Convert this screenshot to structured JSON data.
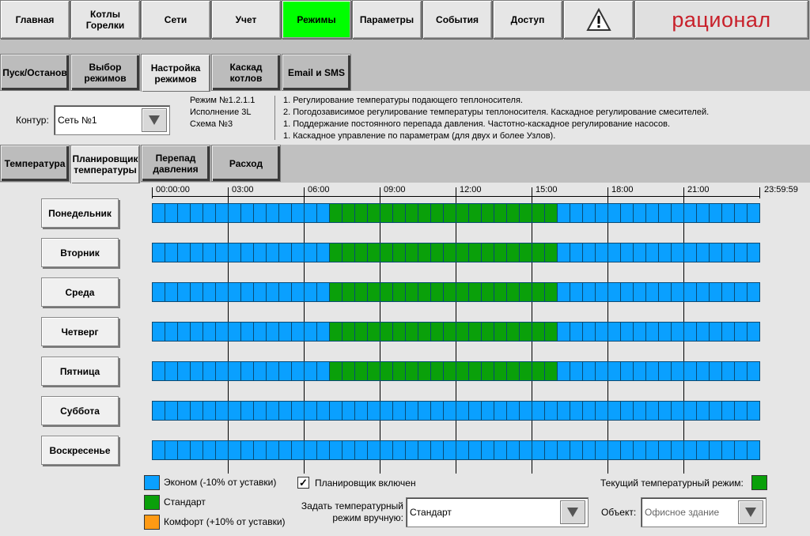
{
  "nav": [
    {
      "label": "Главная",
      "active": false
    },
    {
      "label": "Котлы\nГорелки",
      "active": false
    },
    {
      "label": "Сети",
      "active": false
    },
    {
      "label": "Учет",
      "active": false
    },
    {
      "label": "Режимы",
      "active": true
    },
    {
      "label": "Параметры",
      "active": false
    },
    {
      "label": "События",
      "active": false
    },
    {
      "label": "Доступ",
      "active": false
    }
  ],
  "brand": {
    "logo": "рационал",
    "color": "#c8202a"
  },
  "tabs1": [
    {
      "label": "Пуск/Останов",
      "active": false
    },
    {
      "label": "Выбор\nрежимов",
      "active": false
    },
    {
      "label": "Настройка\nрежимов",
      "active": true
    },
    {
      "label": "Каскад\nкотлов",
      "active": false
    },
    {
      "label": "Email и SMS",
      "active": false
    }
  ],
  "contour": {
    "label": "Контур:",
    "value": "Сеть №1"
  },
  "mode": {
    "lines": [
      "Режим №1.2.1.1",
      "Исполнение 3L",
      "Схема №3"
    ]
  },
  "description": [
    "1. Регулирование температуры подающего теплоносителя.",
    "2. Погодозависимое регулирование температуры теплоносителя. Каскадное регулирование смесителей.",
    "1. Поддержание постоянного перепада давления. Частотно-каскадное регулирование насосов.",
    "1. Каскадное управление по параметрам (для двух и более Узлов)."
  ],
  "tabs2": [
    {
      "label": "Температура",
      "active": false
    },
    {
      "label": "Планировщик\nтемпературы",
      "active": true
    },
    {
      "label": "Перепад\nдавления",
      "active": false
    },
    {
      "label": "Расход",
      "active": false
    }
  ],
  "timeline": [
    "00:00:00",
    "03:00",
    "06:00",
    "09:00",
    "12:00",
    "15:00",
    "18:00",
    "21:00",
    "23:59:59"
  ],
  "colors": {
    "econom": "#0aa0ff",
    "standard": "#0aa00a",
    "comfort": "#ff9a14"
  },
  "schedule": [
    {
      "day": "Понедельник",
      "standard": [
        7,
        16
      ]
    },
    {
      "day": "Вторник",
      "standard": [
        7,
        16
      ]
    },
    {
      "day": "Среда",
      "standard": [
        7,
        16
      ]
    },
    {
      "day": "Четверг",
      "standard": [
        7,
        16
      ]
    },
    {
      "day": "Пятница",
      "standard": [
        7,
        16
      ]
    },
    {
      "day": "Суббота",
      "standard": null
    },
    {
      "day": "Воскресенье",
      "standard": null
    }
  ],
  "legend": {
    "econom": "Эконом (-10% от уставки)",
    "standard": "Стандарт",
    "comfort": "Комфорт (+10% от уставки)"
  },
  "scheduler": {
    "label": "Планировщик включен",
    "checked": true
  },
  "manual": {
    "label": "Задать температурный\nрежим вручную:",
    "value": "Стандарт"
  },
  "current": {
    "label": "Текущий температурный режим:",
    "mode": "standard"
  },
  "object": {
    "label": "Объект:",
    "value": "Офисное здание"
  }
}
